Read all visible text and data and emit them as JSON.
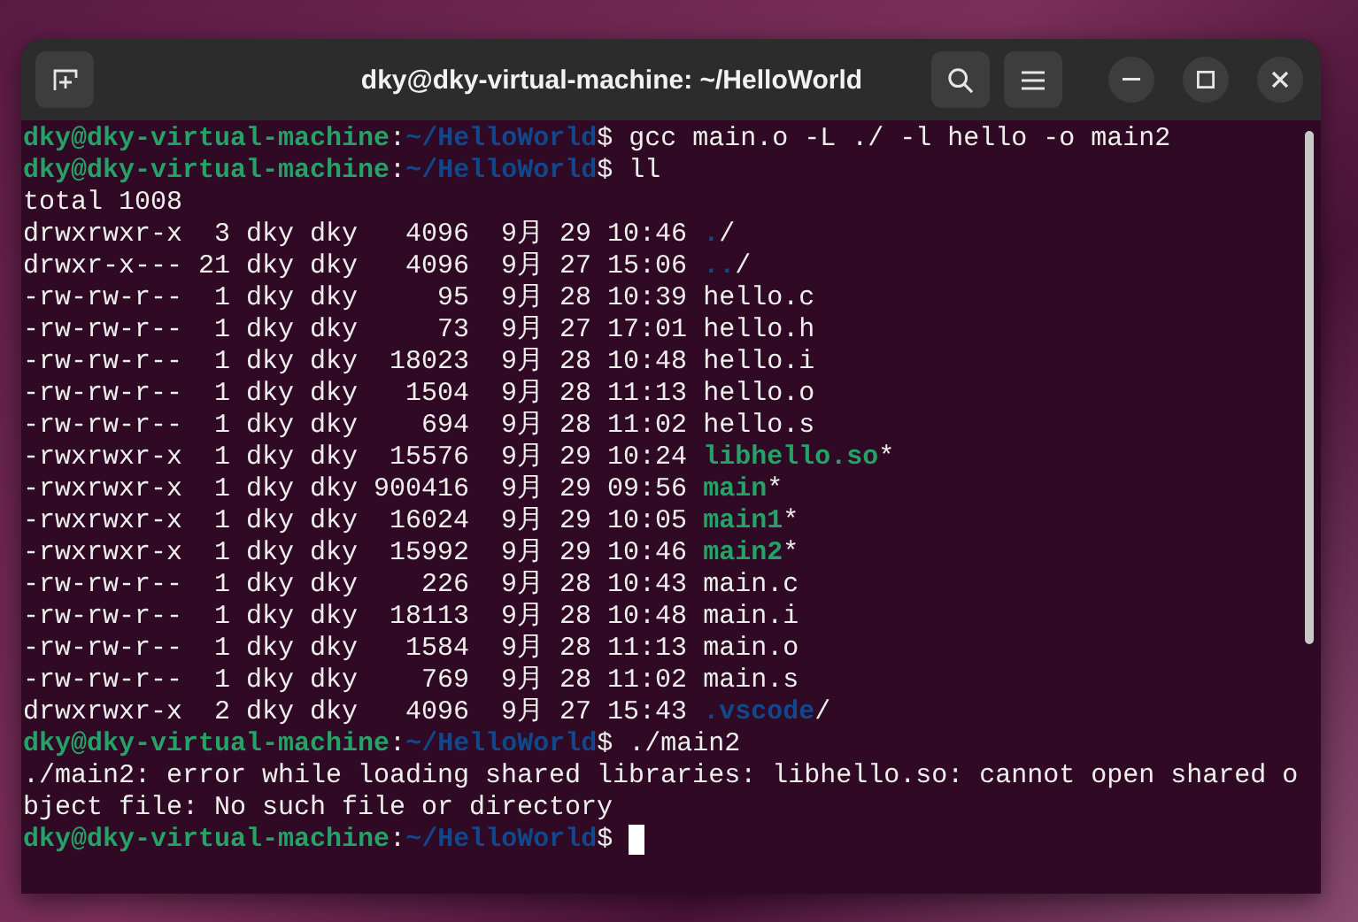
{
  "window": {
    "title": "dky@dky-virtual-machine: ~/HelloWorld"
  },
  "terminal": {
    "lines": [
      {
        "kind": "prompt",
        "user": "dky@dky-virtual-machine",
        "sep": ":",
        "path": "~/HelloWorld",
        "sign": "$",
        "command": "gcc main.o -L ./ -l hello -o main2"
      },
      {
        "kind": "prompt",
        "user": "dky@dky-virtual-machine",
        "sep": ":",
        "path": "~/HelloWorld",
        "sign": "$",
        "command": "ll"
      },
      {
        "kind": "text",
        "text": "total 1008"
      },
      {
        "kind": "dir",
        "info": "drwxrwxr-x  3 dky dky   4096  9月 29 10:46",
        "name": ".",
        "suffix": "/"
      },
      {
        "kind": "dir",
        "info": "drwxr-x--- 21 dky dky   4096  9月 27 15:06",
        "name": "..",
        "suffix": "/"
      },
      {
        "kind": "file",
        "info": "-rw-rw-r--  1 dky dky     95  9月 28 10:39",
        "name": "hello.c"
      },
      {
        "kind": "file",
        "info": "-rw-rw-r--  1 dky dky     73  9月 27 17:01",
        "name": "hello.h"
      },
      {
        "kind": "file",
        "info": "-rw-rw-r--  1 dky dky  18023  9月 28 10:48",
        "name": "hello.i"
      },
      {
        "kind": "file",
        "info": "-rw-rw-r--  1 dky dky   1504  9月 28 11:13",
        "name": "hello.o"
      },
      {
        "kind": "file",
        "info": "-rw-rw-r--  1 dky dky    694  9月 28 11:02",
        "name": "hello.s"
      },
      {
        "kind": "exec",
        "info": "-rwxrwxr-x  1 dky dky  15576  9月 29 10:24",
        "name": "libhello.so",
        "suffix": "*"
      },
      {
        "kind": "exec",
        "info": "-rwxrwxr-x  1 dky dky 900416  9月 29 09:56",
        "name": "main",
        "suffix": "*"
      },
      {
        "kind": "exec",
        "info": "-rwxrwxr-x  1 dky dky  16024  9月 29 10:05",
        "name": "main1",
        "suffix": "*"
      },
      {
        "kind": "exec",
        "info": "-rwxrwxr-x  1 dky dky  15992  9月 29 10:46",
        "name": "main2",
        "suffix": "*"
      },
      {
        "kind": "file",
        "info": "-rw-rw-r--  1 dky dky    226  9月 28 10:43",
        "name": "main.c"
      },
      {
        "kind": "file",
        "info": "-rw-rw-r--  1 dky dky  18113  9月 28 10:48",
        "name": "main.i"
      },
      {
        "kind": "file",
        "info": "-rw-rw-r--  1 dky dky   1584  9月 28 11:13",
        "name": "main.o"
      },
      {
        "kind": "file",
        "info": "-rw-rw-r--  1 dky dky    769  9月 28 11:02",
        "name": "main.s"
      },
      {
        "kind": "dir",
        "info": "drwxrwxr-x  2 dky dky   4096  9月 27 15:43",
        "name": ".vscode",
        "suffix": "/"
      },
      {
        "kind": "prompt",
        "user": "dky@dky-virtual-machine",
        "sep": ":",
        "path": "~/HelloWorld",
        "sign": "$",
        "command": "./main2"
      },
      {
        "kind": "text",
        "text": "./main2: error while loading shared libraries: libhello.so: cannot open shared o"
      },
      {
        "kind": "text",
        "text": "bject file: No such file or directory"
      },
      {
        "kind": "prompt",
        "user": "dky@dky-virtual-machine",
        "sep": ":",
        "path": "~/HelloWorld",
        "sign": "$",
        "cursor": true
      }
    ]
  }
}
